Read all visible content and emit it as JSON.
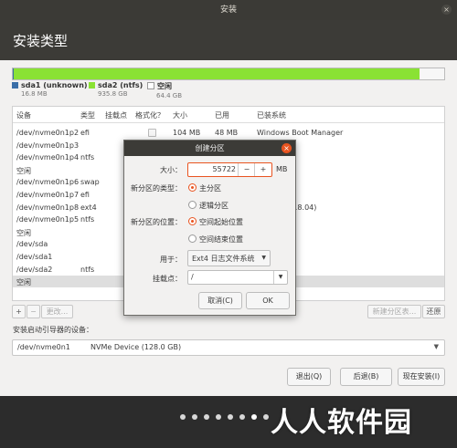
{
  "window": {
    "title": "安装",
    "close_glyph": "×"
  },
  "header": {
    "title": "安装类型"
  },
  "legend": [
    {
      "name": "sda1 (unknown)",
      "size": "16.8 MB",
      "color": "#3b6fa8"
    },
    {
      "name": "sda2 (ntfs)",
      "size": "935.8 GB",
      "color": "#8ae234"
    },
    {
      "name": "空闲",
      "size": "64.4 GB",
      "color": "#ffffff"
    }
  ],
  "table": {
    "columns": [
      "设备",
      "类型",
      "挂载点",
      "格式化？",
      "大小",
      "已用",
      "已装系统"
    ],
    "rows": [
      {
        "device": "/dev/nvme0n1p2",
        "type": "efi",
        "size": "104 MB",
        "used": "48 MB",
        "system": "Windows Boot Manager",
        "checkbox": true
      },
      {
        "device": "/dev/nvme0n1p3",
        "type": "",
        "size": "",
        "used": "",
        "system": ""
      },
      {
        "device": "/dev/nvme0n1p4",
        "type": "ntfs",
        "size": "",
        "used": "",
        "system": ""
      },
      {
        "device": "空闲",
        "type": "",
        "size": "",
        "used": "",
        "system": ""
      },
      {
        "device": "/dev/nvme0n1p6",
        "type": "swap",
        "size": "",
        "used": "",
        "system": ""
      },
      {
        "device": "/dev/nvme0n1p7",
        "type": "efi",
        "size": "",
        "used": "",
        "system": ""
      },
      {
        "device": "/dev/nvme0n1p8",
        "type": "ext4",
        "size": "",
        "used": "",
        "system": "04.1 LTS (18.04)"
      },
      {
        "device": "/dev/nvme0n1p5",
        "type": "ntfs",
        "size": "",
        "used": "",
        "system": ""
      },
      {
        "device": "空闲",
        "type": "",
        "size": "",
        "used": "",
        "system": ""
      },
      {
        "device": "/dev/sda",
        "type": "",
        "size": "",
        "used": "",
        "system": ""
      },
      {
        "device": "/dev/sda1",
        "type": "",
        "size": "",
        "used": "",
        "system": ""
      },
      {
        "device": "/dev/sda2",
        "type": "ntfs",
        "size": "",
        "used": "",
        "system": ""
      },
      {
        "device": "空闲",
        "type": "",
        "size": "",
        "used": "",
        "system": "",
        "selected": true
      }
    ]
  },
  "table_buttons": {
    "add": "+",
    "remove": "−",
    "change": "更改...",
    "new_table": "新建分区表...",
    "revert": "还原"
  },
  "boot": {
    "label": "安装启动引导器的设备：",
    "device": "/dev/nvme0n1",
    "description": "NVMe Device (128.0 GB)"
  },
  "footer": {
    "quit": "退出(Q)",
    "back": "后退(B)",
    "install": "现在安装(I)"
  },
  "dialog": {
    "title": "创建分区",
    "size_label": "大小：",
    "size_value": "55722",
    "size_unit": "MB",
    "minus": "−",
    "plus": "+",
    "type_label": "新分区的类型：",
    "type_primary": "主分区",
    "type_logical": "逻辑分区",
    "location_label": "新分区的位置：",
    "location_start": "空间起始位置",
    "location_end": "空间结束位置",
    "use_label": "用于：",
    "use_value": "Ext4 日志文件系统",
    "mount_label": "挂载点：",
    "mount_value": "/",
    "cancel": "取消(C)",
    "ok": "OK"
  },
  "watermark": "人人软件园",
  "pager": {
    "total": 8,
    "current": 7
  }
}
